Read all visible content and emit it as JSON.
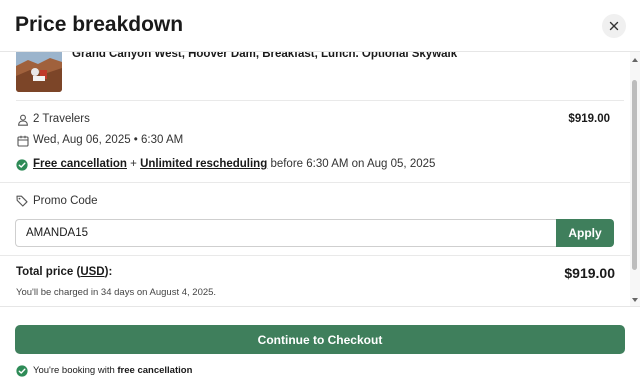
{
  "header": {
    "title": "Price breakdown",
    "close_icon": "close-icon"
  },
  "tour": {
    "name": "Grand Canyon West, Hoover Dam, Breakfast, Lunch. Optional Skywalk"
  },
  "booking": {
    "travelers": "2 Travelers",
    "price": "$919.00",
    "date_time": "Wed, Aug 06, 2025 • 6:30 AM",
    "free_cancellation": "Free cancellation",
    "plus": " + ",
    "unlimited_rescheduling": "Unlimited rescheduling",
    "cancellation_deadline": " before 6:30 AM on Aug 05, 2025"
  },
  "promo": {
    "label": "Promo Code",
    "value": "AMANDA15",
    "apply_label": "Apply"
  },
  "total": {
    "label": "Total price (",
    "currency": "USD",
    "label_end": "):",
    "amount": "$919.00",
    "charge_note": "You'll be charged in 34 days on August 4, 2025."
  },
  "footer": {
    "checkout_label": "Continue to Checkout",
    "booking_note": "You're booking with ",
    "booking_note_bold": "free cancellation"
  },
  "colors": {
    "accent": "#3f7f5c",
    "check": "#2e8b57"
  }
}
